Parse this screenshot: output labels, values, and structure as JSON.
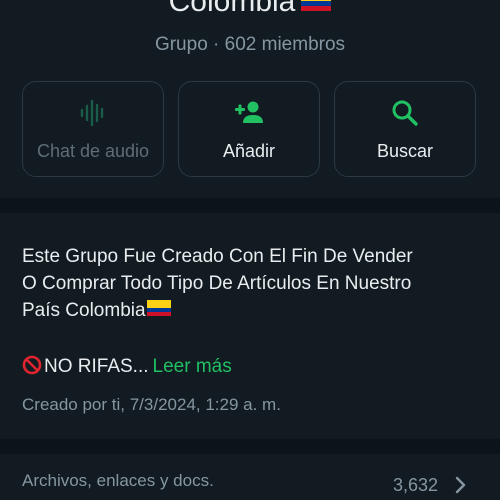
{
  "group": {
    "name": "Colombia",
    "meta": "Grupo · 602 miembros"
  },
  "actions": [
    {
      "label": "Chat de audio",
      "icon": "audio-waveform-icon",
      "enabled": false
    },
    {
      "label": "Añadir",
      "icon": "add-person-icon",
      "enabled": true
    },
    {
      "label": "Buscar",
      "icon": "search-icon",
      "enabled": true
    }
  ],
  "description": {
    "lines": [
      "Este Grupo Fue Creado Con El Fin De Vender",
      "O Comprar Todo Tipo De Artículos En Nuestro",
      "País Colombia"
    ],
    "rifas": "NO RIFAS...",
    "read_more": "Leer más",
    "created": "Creado por ti, 7/3/2024, 1:29 a. m."
  },
  "files": {
    "label": "Archivos, enlaces y docs.",
    "count": "3,632"
  },
  "colors": {
    "accent": "#21c063",
    "background": "#111b21",
    "separator": "#0b141a",
    "text": "#e9edef",
    "muted": "#8696a0"
  }
}
